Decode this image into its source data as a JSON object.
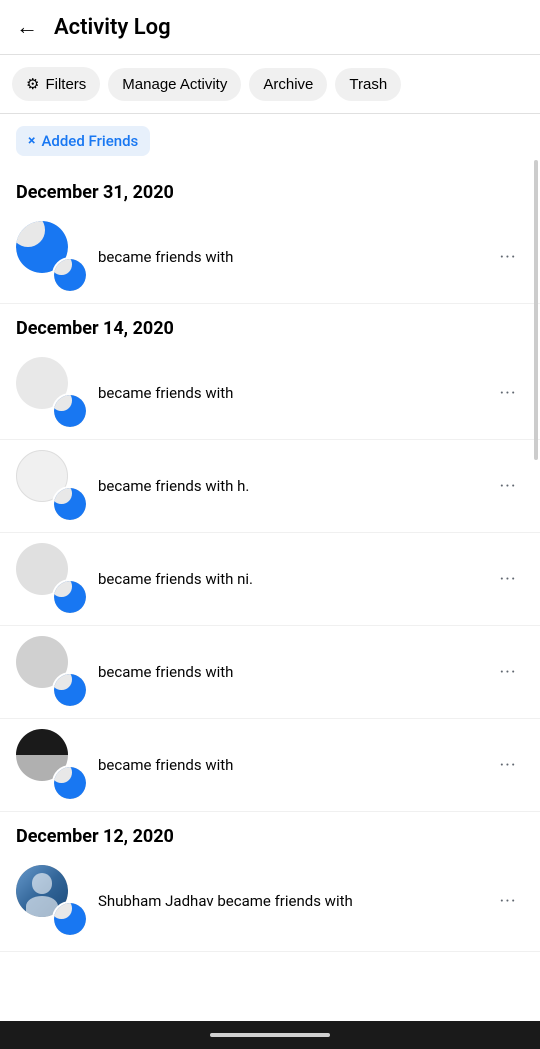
{
  "header": {
    "back_label": "←",
    "title": "Activity Log"
  },
  "toolbar": {
    "filters_label": "Filters",
    "manage_label": "Manage Activity",
    "archive_label": "Archive",
    "trash_label": "Trash"
  },
  "active_filter": {
    "close_icon": "×",
    "label": "Added Friends"
  },
  "sections": [
    {
      "date": "December 31, 2020",
      "items": [
        {
          "id": "item-1",
          "text": "became friends with",
          "more": "···"
        }
      ]
    },
    {
      "date": "December 14, 2020",
      "items": [
        {
          "id": "item-2",
          "text": "became friends with",
          "more": "···"
        },
        {
          "id": "item-3",
          "text": "became friends with h.",
          "more": "···"
        },
        {
          "id": "item-4",
          "text": "became friends with ni.",
          "more": "···"
        },
        {
          "id": "item-5",
          "text": "became friends with",
          "more": "···"
        },
        {
          "id": "item-6",
          "text": "became friends with",
          "more": "···"
        }
      ]
    },
    {
      "date": "December 12, 2020",
      "items": [
        {
          "id": "item-7",
          "text": "Shubham Jadhav became friends with",
          "more": "···",
          "has_photo": true
        }
      ]
    }
  ]
}
